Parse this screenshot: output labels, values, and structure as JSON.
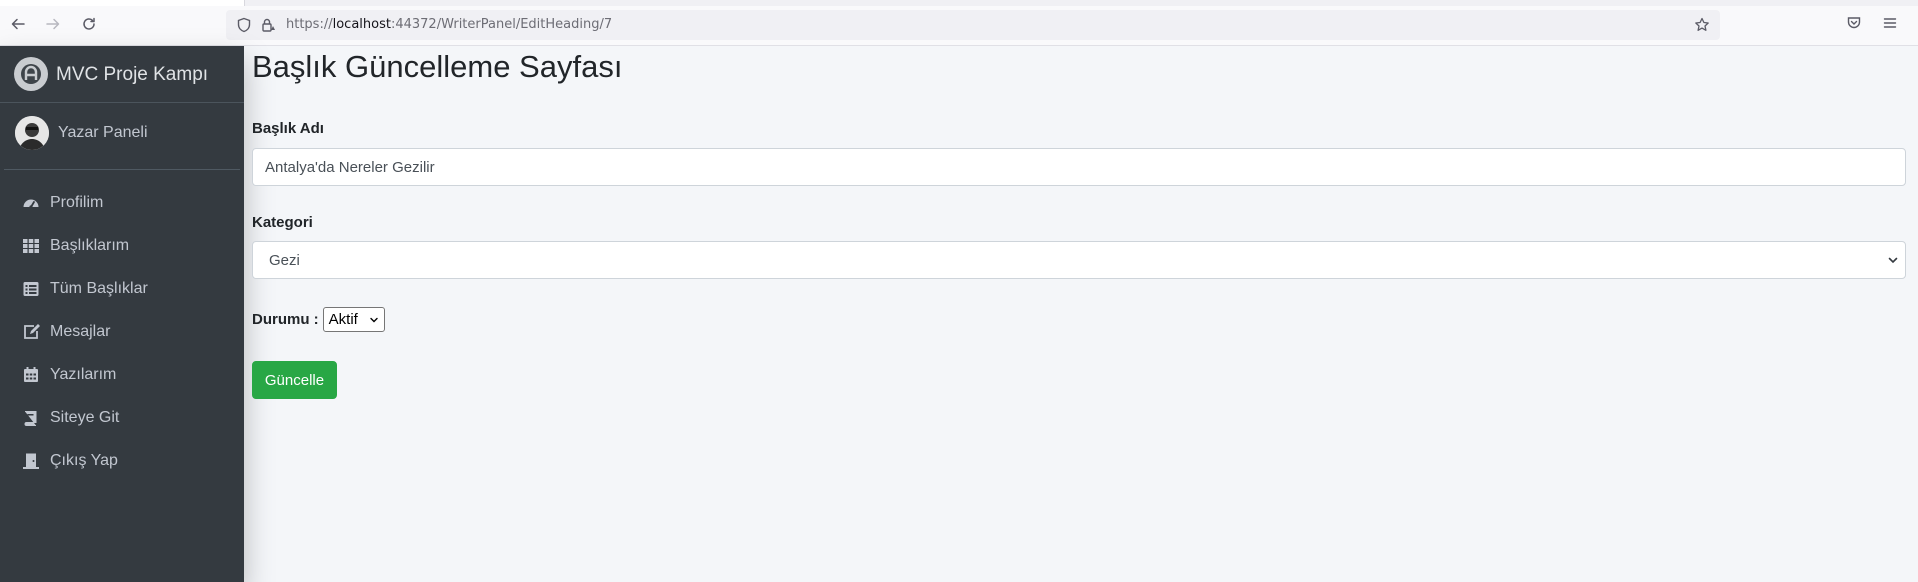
{
  "browser": {
    "url_prefix": "https://",
    "url_host": "localhost",
    "url_rest": ":44372/WriterPanel/EditHeading/7"
  },
  "sidebar": {
    "brand": "MVC Proje Kampı",
    "user_name": "Yazar Paneli",
    "items": [
      {
        "label": "Profilim",
        "icon": "tachometer-icon"
      },
      {
        "label": "Başlıklarım",
        "icon": "grid-icon"
      },
      {
        "label": "Tüm Başlıklar",
        "icon": "list-icon"
      },
      {
        "label": "Mesajlar",
        "icon": "edit-icon"
      },
      {
        "label": "Yazılarım",
        "icon": "calendar-icon"
      },
      {
        "label": "Siteye Git",
        "icon": "book-icon"
      },
      {
        "label": "Çıkış Yap",
        "icon": "door-icon"
      }
    ]
  },
  "main": {
    "title": "Başlık Güncelleme Sayfası",
    "heading_label": "Başlık Adı",
    "heading_value": "Antalya'da Nereler Gezilir",
    "category_label": "Kategori",
    "category_value": "Gezi",
    "status_label": "Durumu :",
    "status_value": "Aktif",
    "submit_label": "Güncelle"
  },
  "colors": {
    "sidebar_bg": "#343a40",
    "content_bg": "#f4f6f9",
    "button_success": "#28a745"
  }
}
